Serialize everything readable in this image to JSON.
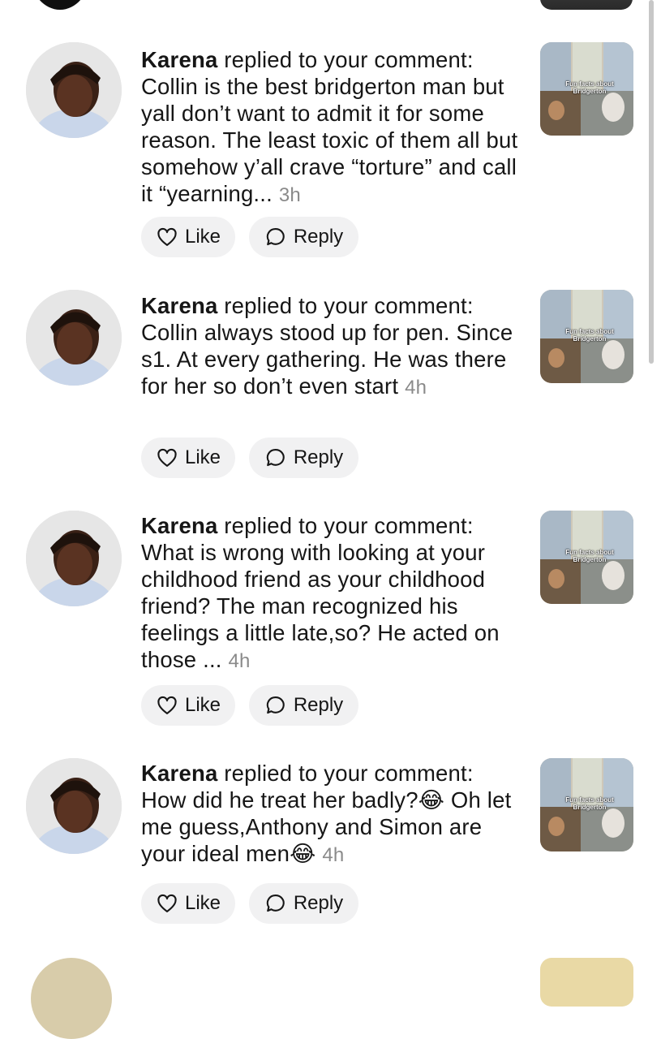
{
  "notifications": [
    {
      "user": "Karena",
      "action": "replied to your comment:",
      "text": "Collin is the best bridgerton man but yall don’t want to admit it for some reason. The least toxic of them all but somehow y’all crave “torture” and call it “yearning...",
      "time": "3h",
      "thumbnail_caption": "Fun facts about Bridgerton",
      "like_label": "Like",
      "reply_label": "Reply"
    },
    {
      "user": "Karena",
      "action": "replied to your comment:",
      "text": "Collin always stood up for pen. Since s1. At every gathering. He was there for her so don’t even start",
      "time": "4h",
      "thumbnail_caption": "Fun facts about Bridgerton",
      "like_label": "Like",
      "reply_label": "Reply"
    },
    {
      "user": "Karena",
      "action": "replied to your comment:",
      "text": "What is wrong with looking at your childhood friend as your childhood friend? The man recognized his feelings a little late,so? He acted on those ...",
      "time": "4h",
      "thumbnail_caption": "Fun facts about Bridgerton",
      "like_label": "Like",
      "reply_label": "Reply"
    },
    {
      "user": "Karena",
      "action": "replied to your comment:",
      "text": "How did he treat her badly?😂 Oh let me guess,Anthony and Simon are your ideal men😂",
      "time": "4h",
      "thumbnail_caption": "Fun facts about Bridgerton",
      "like_label": "Like",
      "reply_label": "Reply"
    }
  ]
}
